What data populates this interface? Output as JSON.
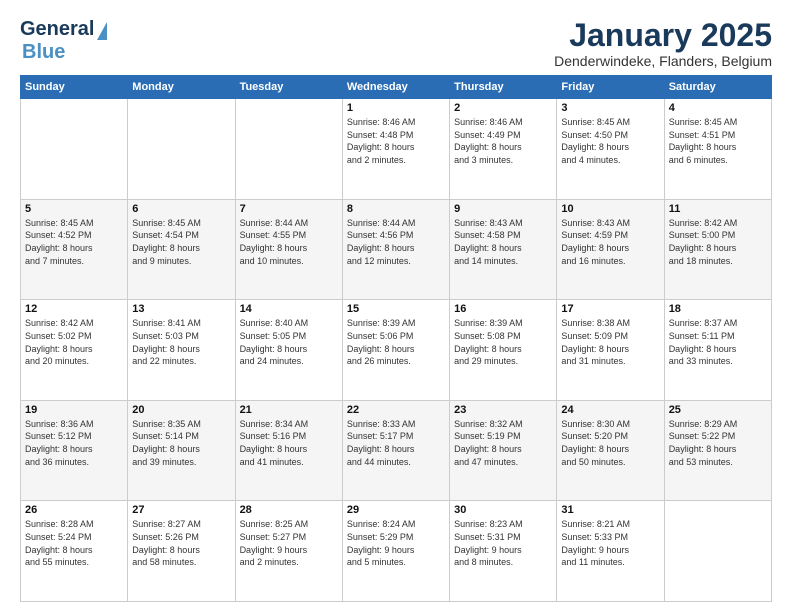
{
  "logo": {
    "line1": "General",
    "line2": "Blue"
  },
  "header": {
    "title": "January 2025",
    "location": "Denderwindeke, Flanders, Belgium"
  },
  "weekdays": [
    "Sunday",
    "Monday",
    "Tuesday",
    "Wednesday",
    "Thursday",
    "Friday",
    "Saturday"
  ],
  "weeks": [
    [
      {
        "day": "",
        "info": ""
      },
      {
        "day": "",
        "info": ""
      },
      {
        "day": "",
        "info": ""
      },
      {
        "day": "1",
        "info": "Sunrise: 8:46 AM\nSunset: 4:48 PM\nDaylight: 8 hours\nand 2 minutes."
      },
      {
        "day": "2",
        "info": "Sunrise: 8:46 AM\nSunset: 4:49 PM\nDaylight: 8 hours\nand 3 minutes."
      },
      {
        "day": "3",
        "info": "Sunrise: 8:45 AM\nSunset: 4:50 PM\nDaylight: 8 hours\nand 4 minutes."
      },
      {
        "day": "4",
        "info": "Sunrise: 8:45 AM\nSunset: 4:51 PM\nDaylight: 8 hours\nand 6 minutes."
      }
    ],
    [
      {
        "day": "5",
        "info": "Sunrise: 8:45 AM\nSunset: 4:52 PM\nDaylight: 8 hours\nand 7 minutes."
      },
      {
        "day": "6",
        "info": "Sunrise: 8:45 AM\nSunset: 4:54 PM\nDaylight: 8 hours\nand 9 minutes."
      },
      {
        "day": "7",
        "info": "Sunrise: 8:44 AM\nSunset: 4:55 PM\nDaylight: 8 hours\nand 10 minutes."
      },
      {
        "day": "8",
        "info": "Sunrise: 8:44 AM\nSunset: 4:56 PM\nDaylight: 8 hours\nand 12 minutes."
      },
      {
        "day": "9",
        "info": "Sunrise: 8:43 AM\nSunset: 4:58 PM\nDaylight: 8 hours\nand 14 minutes."
      },
      {
        "day": "10",
        "info": "Sunrise: 8:43 AM\nSunset: 4:59 PM\nDaylight: 8 hours\nand 16 minutes."
      },
      {
        "day": "11",
        "info": "Sunrise: 8:42 AM\nSunset: 5:00 PM\nDaylight: 8 hours\nand 18 minutes."
      }
    ],
    [
      {
        "day": "12",
        "info": "Sunrise: 8:42 AM\nSunset: 5:02 PM\nDaylight: 8 hours\nand 20 minutes."
      },
      {
        "day": "13",
        "info": "Sunrise: 8:41 AM\nSunset: 5:03 PM\nDaylight: 8 hours\nand 22 minutes."
      },
      {
        "day": "14",
        "info": "Sunrise: 8:40 AM\nSunset: 5:05 PM\nDaylight: 8 hours\nand 24 minutes."
      },
      {
        "day": "15",
        "info": "Sunrise: 8:39 AM\nSunset: 5:06 PM\nDaylight: 8 hours\nand 26 minutes."
      },
      {
        "day": "16",
        "info": "Sunrise: 8:39 AM\nSunset: 5:08 PM\nDaylight: 8 hours\nand 29 minutes."
      },
      {
        "day": "17",
        "info": "Sunrise: 8:38 AM\nSunset: 5:09 PM\nDaylight: 8 hours\nand 31 minutes."
      },
      {
        "day": "18",
        "info": "Sunrise: 8:37 AM\nSunset: 5:11 PM\nDaylight: 8 hours\nand 33 minutes."
      }
    ],
    [
      {
        "day": "19",
        "info": "Sunrise: 8:36 AM\nSunset: 5:12 PM\nDaylight: 8 hours\nand 36 minutes."
      },
      {
        "day": "20",
        "info": "Sunrise: 8:35 AM\nSunset: 5:14 PM\nDaylight: 8 hours\nand 39 minutes."
      },
      {
        "day": "21",
        "info": "Sunrise: 8:34 AM\nSunset: 5:16 PM\nDaylight: 8 hours\nand 41 minutes."
      },
      {
        "day": "22",
        "info": "Sunrise: 8:33 AM\nSunset: 5:17 PM\nDaylight: 8 hours\nand 44 minutes."
      },
      {
        "day": "23",
        "info": "Sunrise: 8:32 AM\nSunset: 5:19 PM\nDaylight: 8 hours\nand 47 minutes."
      },
      {
        "day": "24",
        "info": "Sunrise: 8:30 AM\nSunset: 5:20 PM\nDaylight: 8 hours\nand 50 minutes."
      },
      {
        "day": "25",
        "info": "Sunrise: 8:29 AM\nSunset: 5:22 PM\nDaylight: 8 hours\nand 53 minutes."
      }
    ],
    [
      {
        "day": "26",
        "info": "Sunrise: 8:28 AM\nSunset: 5:24 PM\nDaylight: 8 hours\nand 55 minutes."
      },
      {
        "day": "27",
        "info": "Sunrise: 8:27 AM\nSunset: 5:26 PM\nDaylight: 8 hours\nand 58 minutes."
      },
      {
        "day": "28",
        "info": "Sunrise: 8:25 AM\nSunset: 5:27 PM\nDaylight: 9 hours\nand 2 minutes."
      },
      {
        "day": "29",
        "info": "Sunrise: 8:24 AM\nSunset: 5:29 PM\nDaylight: 9 hours\nand 5 minutes."
      },
      {
        "day": "30",
        "info": "Sunrise: 8:23 AM\nSunset: 5:31 PM\nDaylight: 9 hours\nand 8 minutes."
      },
      {
        "day": "31",
        "info": "Sunrise: 8:21 AM\nSunset: 5:33 PM\nDaylight: 9 hours\nand 11 minutes."
      },
      {
        "day": "",
        "info": ""
      }
    ]
  ]
}
